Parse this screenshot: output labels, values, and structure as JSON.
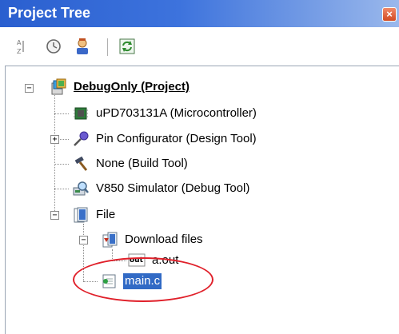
{
  "window": {
    "title": "Project Tree",
    "close_glyph": "×"
  },
  "toolbar": {
    "buttons": [
      {
        "name": "sort-ascending-icon"
      },
      {
        "name": "history-icon"
      },
      {
        "name": "user-icon"
      },
      {
        "name": "refresh-icon"
      }
    ]
  },
  "tree": {
    "expand_glyph": "+",
    "collapse_glyph": "−",
    "project": "DebugOnly (Project)",
    "microcontroller": "uPD703131A (Microcontroller)",
    "pin_configurator": "Pin Configurator (Design Tool)",
    "build_tool": "None (Build Tool)",
    "debug_tool": "V850 Simulator (Debug Tool)",
    "file_folder": "File",
    "download_folder": "Download files",
    "aout": "a.out",
    "mainc": "main.c",
    "aout_icon_text": "out"
  },
  "colors": {
    "titlebar": "#2a5fcf",
    "selection": "#316ac5",
    "highlight_ellipse": "#e0202a"
  }
}
